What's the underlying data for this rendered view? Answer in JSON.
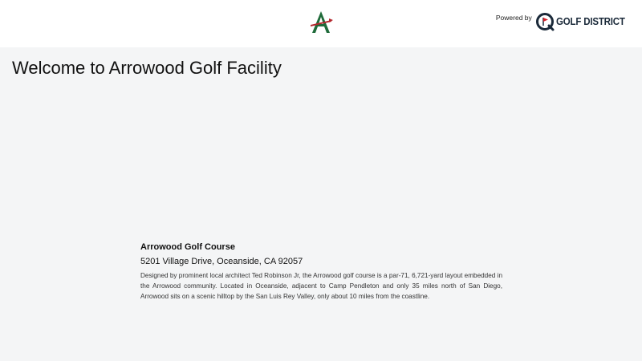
{
  "header": {
    "logo_icon": "arrowood-a-logo",
    "powered_by_label": "Powered by",
    "brand_icon": "golf-district-flag-icon",
    "brand_name": "GOLF DISTRICT",
    "colors": {
      "logo_green": "#1f6b3a",
      "logo_red": "#b3262d",
      "brand_dark": "#1b2a3a",
      "brand_red": "#d6202a"
    }
  },
  "main": {
    "title": "Welcome to Arrowood Golf Facility",
    "course": {
      "name": "Arrowood Golf Course",
      "address": "5201 Village Drive, Oceanside, CA 92057",
      "description": "Designed by prominent local architect Ted Robinson Jr, the Arrowood golf course is a par-71, 6,721-yard layout embedded in the Arrowood community. Located in Oceanside, adjacent to Camp Pendleton and only 35 miles north of San Diego, Arrowood sits on a scenic hilltop by the San Luis Rey Valley, only about 10 miles from the coastline."
    }
  }
}
